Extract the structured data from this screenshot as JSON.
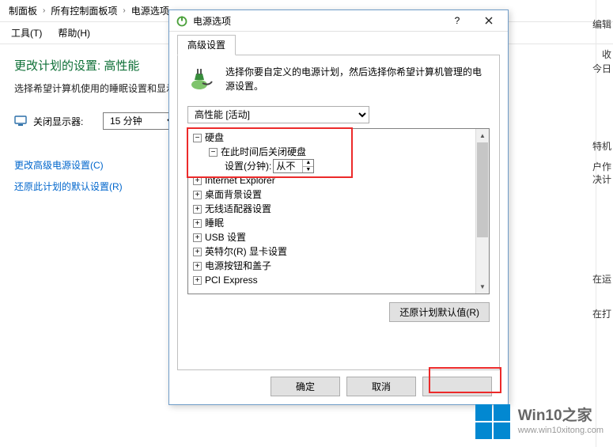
{
  "bg": {
    "breadcrumb": {
      "items": [
        "制面板",
        "所有控制面板项",
        "电源选项"
      ]
    },
    "menubar": {
      "tools": "工具(T)",
      "help": "帮助(H)"
    },
    "title": "更改计划的设置: 高性能",
    "subtitle": "选择希望计算机使用的睡眠设置和显示",
    "row_display_off_label": "关闭显示器:",
    "row_display_off_value": "15 分钟",
    "link_advanced": "更改高级电源设置(C)",
    "link_restore_defaults": "还原此计划的默认设置(R)"
  },
  "dialog": {
    "title": "电源选项",
    "tab_label": "高级设置",
    "description": "选择你要自定义的电源计划，然后选择你希望计算机管理的电源设置。",
    "plan_selected": "高性能 [活动]",
    "tree": {
      "hdd": "硬盘",
      "hdd_off_after": "在此时间后关闭硬盘",
      "setting_label": "设置(分钟):",
      "setting_value": "从不",
      "items": [
        "Internet Explorer",
        "桌面背景设置",
        "无线适配器设置",
        "睡眠",
        "USB 设置",
        "英特尔(R) 显卡设置",
        "电源按钮和盖子",
        "PCI Express"
      ]
    },
    "btn_restore": "还原计划默认值(R)",
    "btn_ok": "确定",
    "btn_cancel": "取消",
    "btn_apply": ""
  },
  "right": {
    "t0": "编辑",
    "t1": "收",
    "t2": "今日",
    "t3": "特机",
    "t4": "户作",
    "t5": "决计",
    "t6": "在运",
    "t7": "在打"
  },
  "watermark": {
    "line1": "Win10之家",
    "line2": "www.win10xitong.com"
  }
}
